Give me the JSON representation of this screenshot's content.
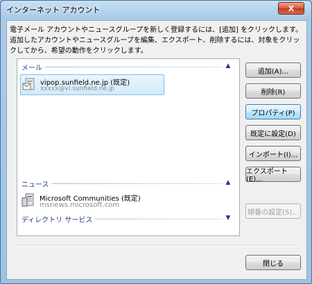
{
  "window": {
    "title": "インターネット アカウント",
    "close_glyph": "X"
  },
  "description": "電子メール アカウントやニュースグループを新しく登録するには、[追加] をクリックします。追加したアカウントやニュースグループを編集、エクスポート、削除するには、対象をクリックしてから、希望の動作をクリックします。",
  "groups": {
    "mail": {
      "label": "メール",
      "chevron": "▲"
    },
    "news": {
      "label": "ニュース",
      "chevron": "▲"
    },
    "directory": {
      "label": "ディレクトリ サービス",
      "chevron": "▼"
    }
  },
  "accounts": {
    "mail": {
      "name": "vipop.sunfield.ne.jp (既定)",
      "address": "xxxxx@vi.sunfield.ne.jp",
      "icon": "mail-account-icon"
    },
    "news": {
      "name": "Microsoft Communities (既定)",
      "address": "msnews.microsoft.com",
      "icon": "news-account-icon"
    }
  },
  "buttons": {
    "add": "追加(A)...",
    "remove": "削除(R)",
    "properties": "プロパティ(P)",
    "set_default": "既定に設定(D)",
    "import": "インポート(I)...",
    "export": "エクスポート(E)...",
    "order": "順番の設定(S)...",
    "close": "閉じる"
  },
  "colors": {
    "group_header": "#1e3b8f",
    "selection": "#d3eafa",
    "close_button": "#c23a1f"
  }
}
